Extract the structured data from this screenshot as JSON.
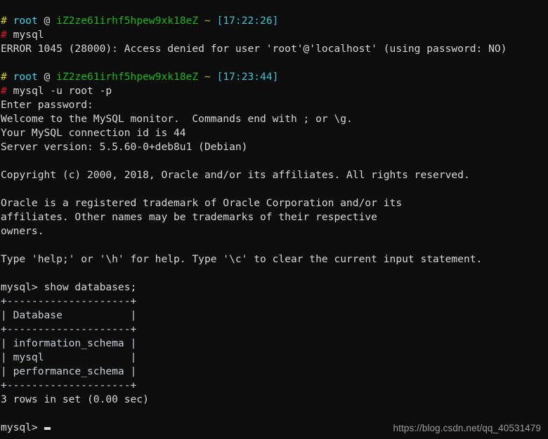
{
  "terminal": {
    "background_color": "#0d0d0d",
    "foreground_color": "#d8d8d8",
    "colors": {
      "prompt_hash": "#d7d700",
      "command_hash": "#e01b24",
      "user": "#2fd7eb",
      "host": "#17b81b",
      "path": "#b8b800",
      "time": "#39c5d4",
      "watermark": "#9b9b9b"
    },
    "prompt1": {
      "hash": "#",
      "user": "root",
      "at": " @ ",
      "host": "iZ2ze61irhf5hpew9xk18eZ",
      "path": " ~ ",
      "time": "[17:22:26]"
    },
    "prompt2": {
      "hash": "#",
      "user": "root",
      "at": " @ ",
      "host": "iZ2ze61irhf5hpew9xk18eZ",
      "path": " ~ ",
      "time": "[17:23:44]"
    },
    "command1": {
      "hash": "#",
      "text": " mysql"
    },
    "command2": {
      "hash": "#",
      "text": " mysql -u root -p"
    },
    "lines": {
      "error": "ERROR 1045 (28000): Access denied for user 'root'@'localhost' (using password: NO)",
      "enter_password": "Enter password:",
      "welcome": "Welcome to the MySQL monitor.  Commands end with ; or \\g.",
      "connection_id": "Your MySQL connection id is 44",
      "server_version": "Server version: 5.5.60-0+deb8u1 (Debian)",
      "copyright": "Copyright (c) 2000, 2018, Oracle and/or its affiliates. All rights reserved.",
      "trademark1": "Oracle is a registered trademark of Oracle Corporation and/or its",
      "trademark2": "affiliates. Other names may be trademarks of their respective",
      "trademark3": "owners.",
      "help": "Type 'help;' or '\\h' for help. Type '\\c' to clear the current input statement.",
      "show_databases": "mysql> show databases;",
      "table_border": "+--------------------+",
      "table_header": "| Database           |",
      "table_row1": "| information_schema |",
      "table_row2": "| mysql              |",
      "table_row3": "| performance_schema |",
      "rows_in_set": "3 rows in set (0.00 sec)",
      "final_prompt": "mysql>"
    }
  },
  "watermark": {
    "text": "https://blog.csdn.net/qq_40531479"
  }
}
